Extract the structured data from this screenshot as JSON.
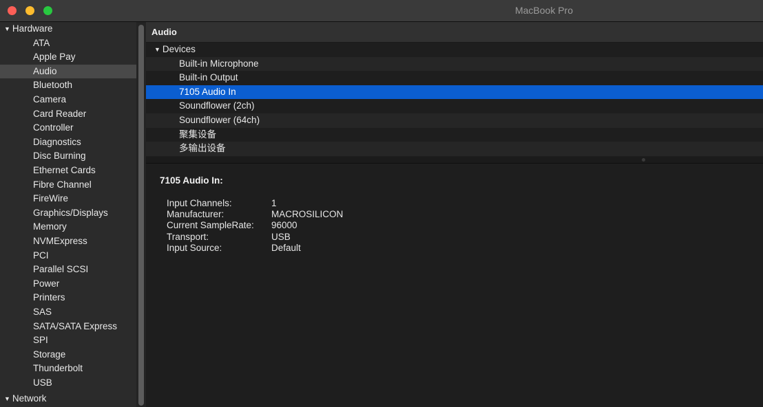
{
  "window": {
    "title": "MacBook Pro"
  },
  "sidebar": {
    "groups": [
      {
        "label": "Hardware",
        "items": [
          "ATA",
          "Apple Pay",
          "Audio",
          "Bluetooth",
          "Camera",
          "Card Reader",
          "Controller",
          "Diagnostics",
          "Disc Burning",
          "Ethernet Cards",
          "Fibre Channel",
          "FireWire",
          "Graphics/Displays",
          "Memory",
          "NVMExpress",
          "PCI",
          "Parallel SCSI",
          "Power",
          "Printers",
          "SAS",
          "SATA/SATA Express",
          "SPI",
          "Storage",
          "Thunderbolt",
          "USB"
        ]
      },
      {
        "label": "Network",
        "items": []
      }
    ],
    "selected": "Audio",
    "disclosure_glyph": "▼"
  },
  "content": {
    "header": "Audio",
    "devices_group": "Devices",
    "devices": [
      "Built-in Microphone",
      "Built-in Output",
      "7105 Audio In",
      "Soundflower (2ch)",
      "Soundflower (64ch)",
      "聚集设备",
      "多输出设备"
    ],
    "selected_device": "7105 Audio In",
    "detail": {
      "title": "7105 Audio In:",
      "properties": [
        {
          "key": "Input Channels:",
          "value": "1"
        },
        {
          "key": "Manufacturer:",
          "value": "MACROSILICON"
        },
        {
          "key": "Current SampleRate:",
          "value": "96000"
        },
        {
          "key": "Transport:",
          "value": "USB"
        },
        {
          "key": "Input Source:",
          "value": "Default"
        }
      ]
    }
  },
  "colors": {
    "selection_blue": "#0b5ed0",
    "sidebar_selection": "#494949",
    "close": "#fe5f57",
    "minimize": "#febc2e",
    "zoom": "#28c840"
  }
}
